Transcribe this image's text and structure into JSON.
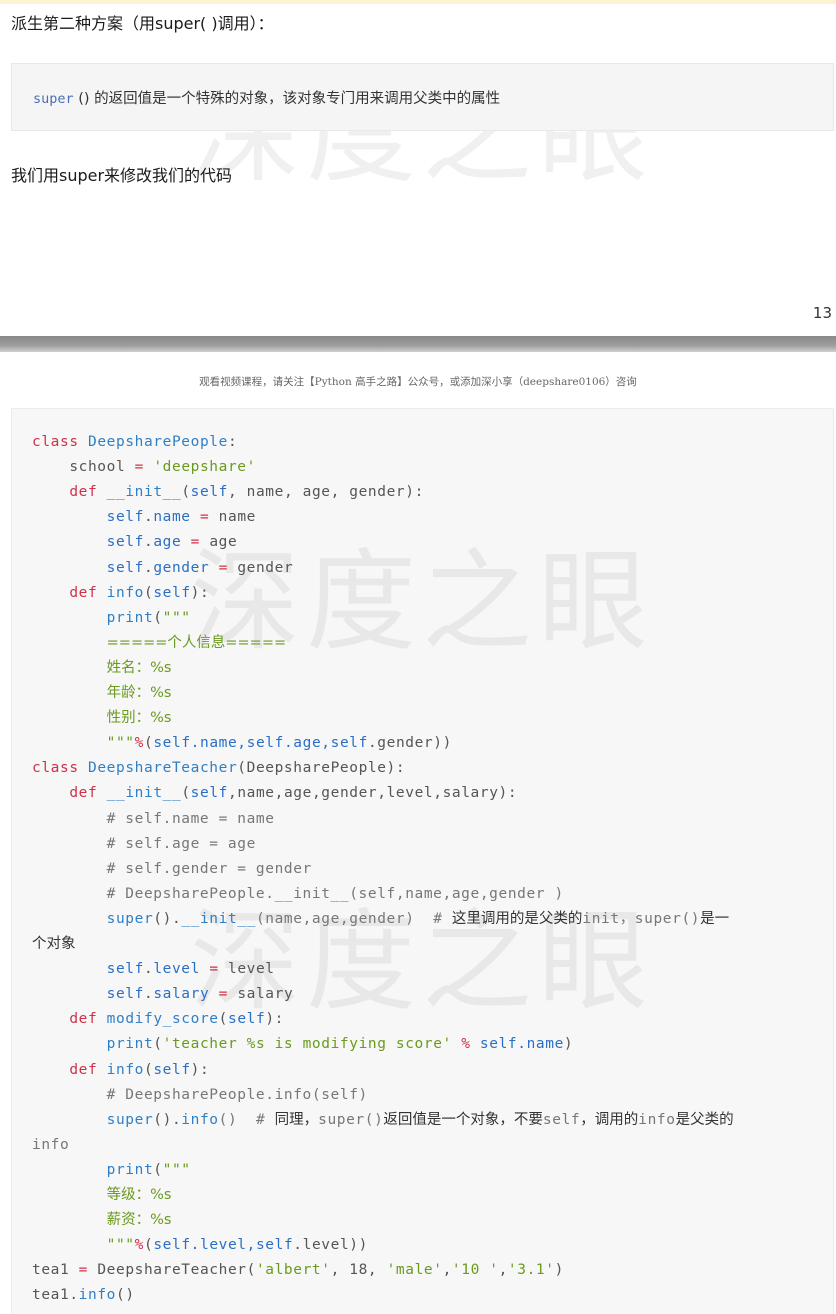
{
  "page_top": {
    "heading": "派生第二种方案（用super( )调用）：",
    "note_keyword": "super",
    "note_text": " () 的返回值是一个特殊的对象，该对象专门用来调用父类中的属性",
    "paragraph": "我们用super来修改我们的代码",
    "page_number": "13"
  },
  "page_bottom": {
    "header": "观看视频课程，请关注【Python 高手之路】公众号，或添加深小享（deepshare0106）咨询"
  },
  "watermark": "深度之眼",
  "code": {
    "l1": [
      "class",
      " ",
      "DeepsharePeople",
      ":"
    ],
    "l2": [
      "    school ",
      "=",
      " ",
      "'deepshare'"
    ],
    "l3": [
      "    ",
      "def",
      " ",
      "__init__",
      "(",
      "self",
      ", name, age, gender):"
    ],
    "l4": [
      "        ",
      "self",
      ".",
      "name",
      " ",
      "=",
      " name"
    ],
    "l5": [
      "        ",
      "self",
      ".",
      "age",
      " ",
      "=",
      " age"
    ],
    "l6": [
      "        ",
      "self",
      ".",
      "gender",
      " ",
      "=",
      " gender"
    ],
    "l7": [
      "    ",
      "def",
      " ",
      "info",
      "(",
      "self",
      "):"
    ],
    "l8": [
      "        ",
      "print",
      "(",
      "\"\"\""
    ],
    "l9": [
      "        ",
      "=====个人信息====="
    ],
    "l10": [
      "        ",
      "姓名：%s"
    ],
    "l11": [
      "        ",
      "年龄：%s"
    ],
    "l12": [
      "        ",
      "性别：%s"
    ],
    "l13": [
      "        ",
      "\"\"\"",
      "%",
      "(",
      "self",
      ".name,",
      "self",
      ".age,",
      "self",
      ".gender))"
    ],
    "l14": [
      "class",
      " ",
      "DeepshareTeacher",
      "(DeepsharePeople):"
    ],
    "l15": [
      "    ",
      "def",
      " ",
      "__init__",
      "(",
      "self",
      ",name,age,gender,level,salary):"
    ],
    "l16": [
      "        # self.name = name"
    ],
    "l17": [
      "        # self.age = age"
    ],
    "l18": [
      "        # self.gender = gender"
    ],
    "l19": [
      "        # DeepsharePeople.__init__(self,name,age,gender )"
    ],
    "l20": [
      "        ",
      "super",
      "().",
      "__init__",
      "(name,age,gender)  # ",
      "这里调用的是父类的",
      "init，super()",
      "是一"
    ],
    "l21": [
      "个对象"
    ],
    "l22": [
      "        ",
      "self",
      ".",
      "level",
      " ",
      "=",
      " level"
    ],
    "l23": [
      "        ",
      "self",
      ".",
      "salary",
      " ",
      "=",
      " salary"
    ],
    "l24": [
      "    ",
      "def",
      " ",
      "modify_score",
      "(",
      "self",
      "):"
    ],
    "l25": [
      "        ",
      "print",
      "(",
      "'teacher %s is modifying score'",
      " ",
      "%",
      " ",
      "self",
      ".",
      "name",
      ")"
    ],
    "l26": [
      "    ",
      "def",
      " ",
      "info",
      "(",
      "self",
      "):"
    ],
    "l27": [
      "        # DeepsharePeople.info(self)"
    ],
    "l28": [
      "        ",
      "super",
      "().",
      "info",
      "()  # ",
      "同理，",
      "super()",
      "返回值是一个对象，不要",
      "self",
      "，调用的",
      "info",
      "是父类的"
    ],
    "l29": [
      "info"
    ],
    "l30": [
      "        ",
      "print",
      "(",
      "\"\"\""
    ],
    "l31": [
      "        ",
      "等级：%s"
    ],
    "l32": [
      "        ",
      "薪资：%s"
    ],
    "l33": [
      "        ",
      "\"\"\"",
      "%",
      "(",
      "self",
      ".level,",
      "self",
      ".level))"
    ],
    "l34": [
      "tea1 ",
      "=",
      " DeepshareTeacher(",
      "'albert'",
      ", ",
      "18",
      ", ",
      "'male'",
      ",",
      "'10 '",
      ",",
      "'3.1'",
      ")"
    ],
    "l35": [
      "tea1.",
      "info",
      "()"
    ]
  }
}
